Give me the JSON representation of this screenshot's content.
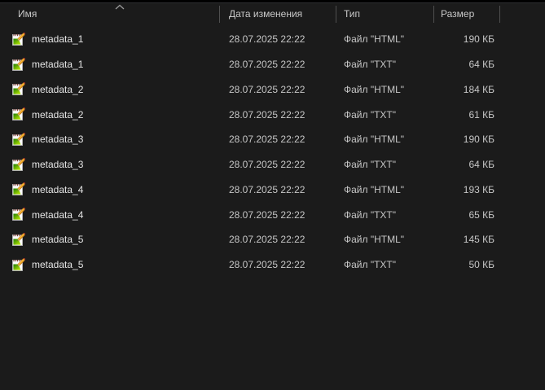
{
  "view": "file-explorer-details-list",
  "header": {
    "columns": [
      {
        "label": "Имя",
        "sorted": "ascending"
      },
      {
        "label": "Дата изменения",
        "sorted": null
      },
      {
        "label": "Тип",
        "sorted": null
      },
      {
        "label": "Размер",
        "sorted": null
      }
    ]
  },
  "files": [
    {
      "name": "metadata_1",
      "modified": "28.07.2025 22:22",
      "type": "Файл \"HTML\"",
      "size": "190 КБ"
    },
    {
      "name": "metadata_1",
      "modified": "28.07.2025 22:22",
      "type": "Файл \"TXT\"",
      "size": "64 КБ"
    },
    {
      "name": "metadata_2",
      "modified": "28.07.2025 22:22",
      "type": "Файл \"HTML\"",
      "size": "184 КБ"
    },
    {
      "name": "metadata_2",
      "modified": "28.07.2025 22:22",
      "type": "Файл \"TXT\"",
      "size": "61 КБ"
    },
    {
      "name": "metadata_3",
      "modified": "28.07.2025 22:22",
      "type": "Файл \"HTML\"",
      "size": "190 КБ"
    },
    {
      "name": "metadata_3",
      "modified": "28.07.2025 22:22",
      "type": "Файл \"TXT\"",
      "size": "64 КБ"
    },
    {
      "name": "metadata_4",
      "modified": "28.07.2025 22:22",
      "type": "Файл \"HTML\"",
      "size": "193 КБ"
    },
    {
      "name": "metadata_4",
      "modified": "28.07.2025 22:22",
      "type": "Файл \"TXT\"",
      "size": "65 КБ"
    },
    {
      "name": "metadata_5",
      "modified": "28.07.2025 22:22",
      "type": "Файл \"HTML\"",
      "size": "145 КБ"
    },
    {
      "name": "metadata_5",
      "modified": "28.07.2025 22:22",
      "type": "Файл \"TXT\"",
      "size": "50 КБ"
    }
  ],
  "icons": {
    "file_icon": "notepad-with-pencil",
    "sort_icon": "chevron-up"
  },
  "colors": {
    "background": "#1b1b1b",
    "top_strip": "#000000",
    "header_text": "#c9c9c9",
    "row_text": "#c6c6c6",
    "name_text": "#e6e6e6",
    "column_separator": "#4f4f4f",
    "icon_green": "#3f9b0b",
    "icon_lime": "#c8f000",
    "icon_pencil_orange": "#f7b733"
  }
}
